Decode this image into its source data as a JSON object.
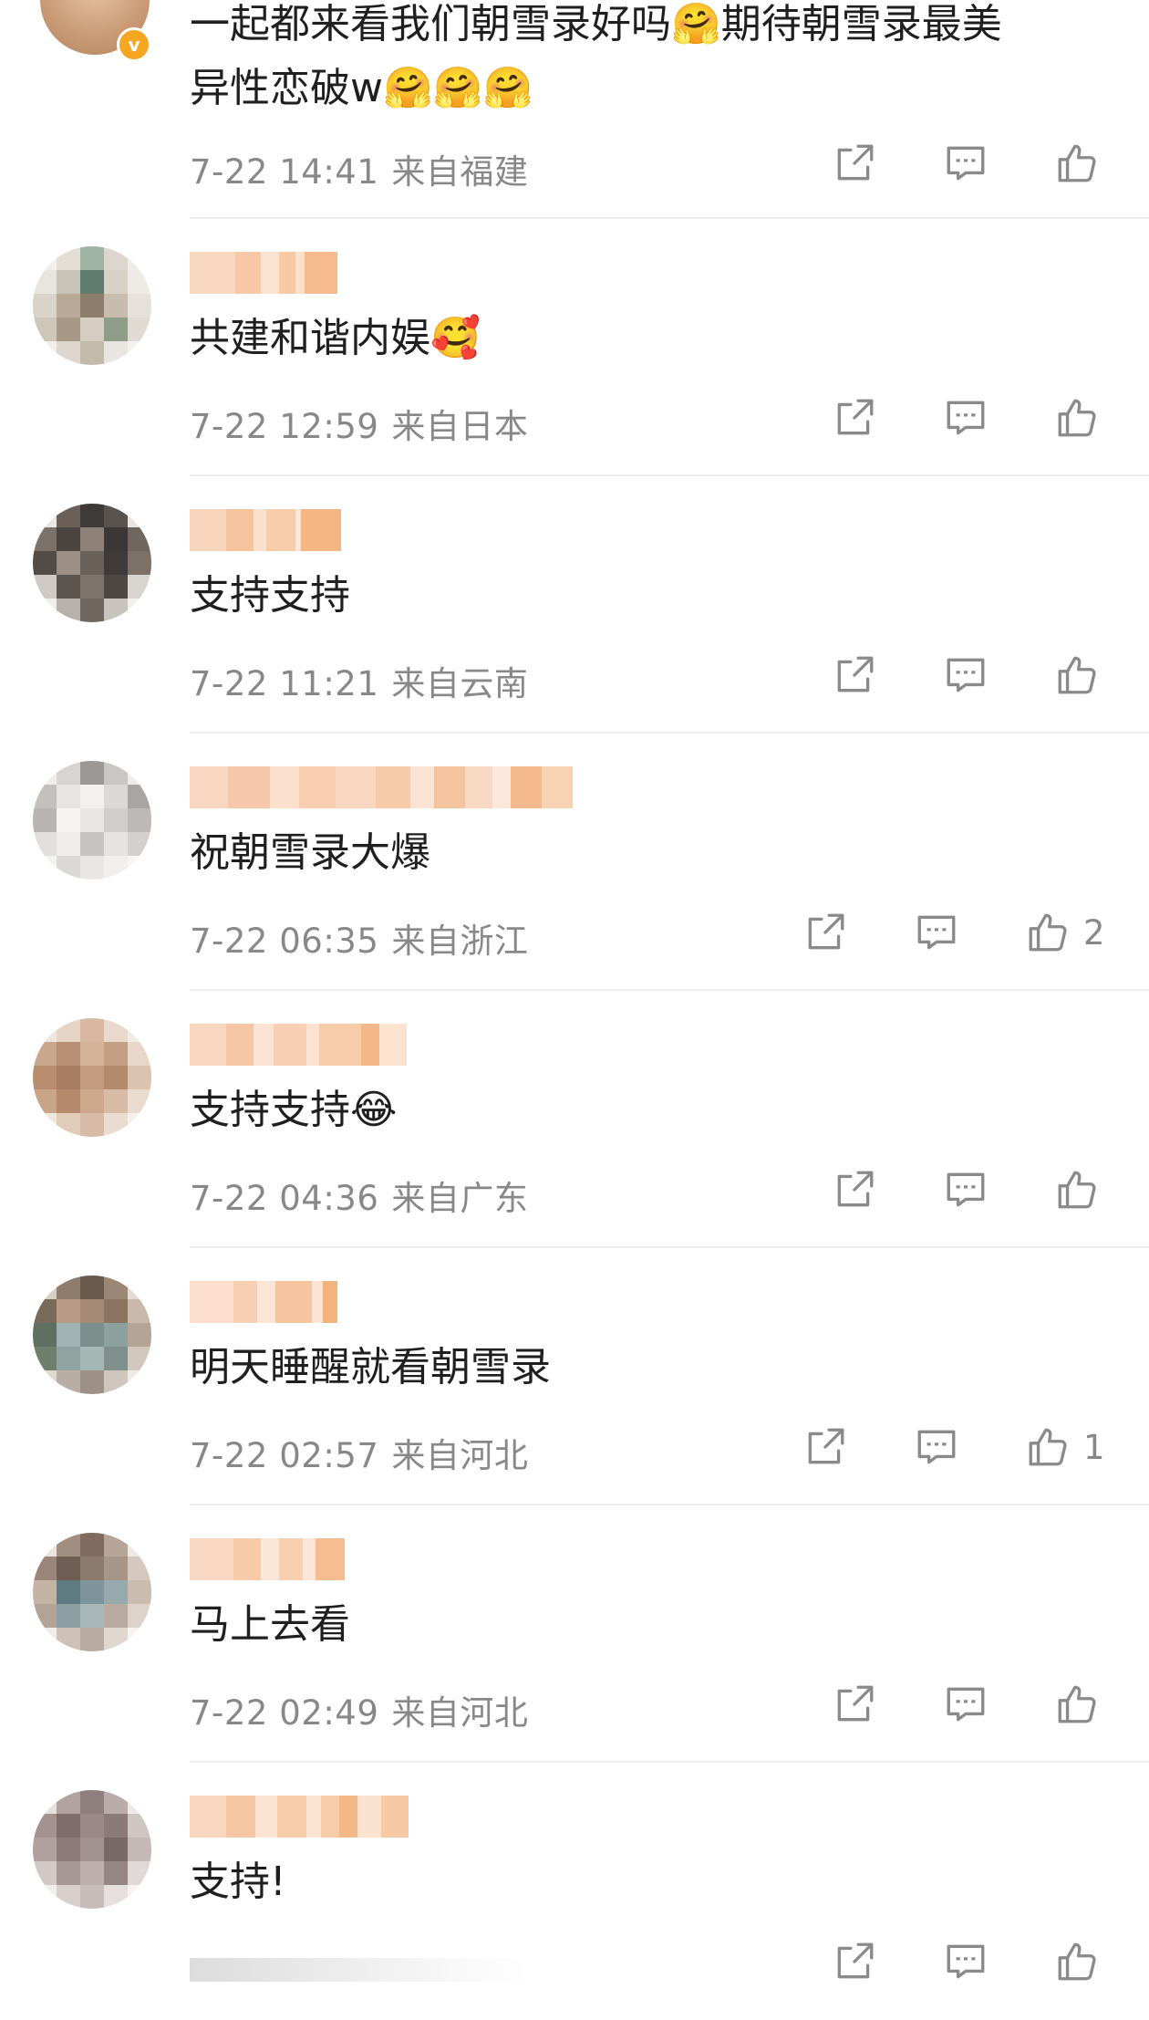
{
  "first_comment": {
    "line1": "一起都来看我们朝雪录好吗🤗期待朝雪录最美",
    "line2": "异性恋破w🤗🤗🤗",
    "date": "7-22 14:41",
    "location": "来自福建",
    "verified_badge": "v"
  },
  "comments": [
    {
      "text": "共建和谐内娱🥰",
      "date": "7-22 12:59",
      "location": "来自日本",
      "likes": ""
    },
    {
      "text": "支持支持",
      "date": "7-22 11:21",
      "location": "来自云南",
      "likes": ""
    },
    {
      "text": "祝朝雪录大爆",
      "date": "7-22 06:35",
      "location": "来自浙江",
      "likes": "2"
    },
    {
      "text": "支持支持😂",
      "date": "7-22 04:36",
      "location": "来自广东",
      "likes": ""
    },
    {
      "text": "明天睡醒就看朝雪录",
      "date": "7-22 02:57",
      "location": "来自河北",
      "likes": "1"
    },
    {
      "text": "马上去看",
      "date": "7-22 02:49",
      "location": "来自河北",
      "likes": ""
    },
    {
      "text": "支持!",
      "date": "",
      "location": "",
      "likes": ""
    }
  ],
  "icons": {
    "share": "share-icon",
    "reply": "comment-icon",
    "like": "thumbs-up-icon"
  },
  "colors": {
    "meta_text": "#888888",
    "divider": "#eeeeee",
    "username_blur": "#f7c9a4"
  }
}
